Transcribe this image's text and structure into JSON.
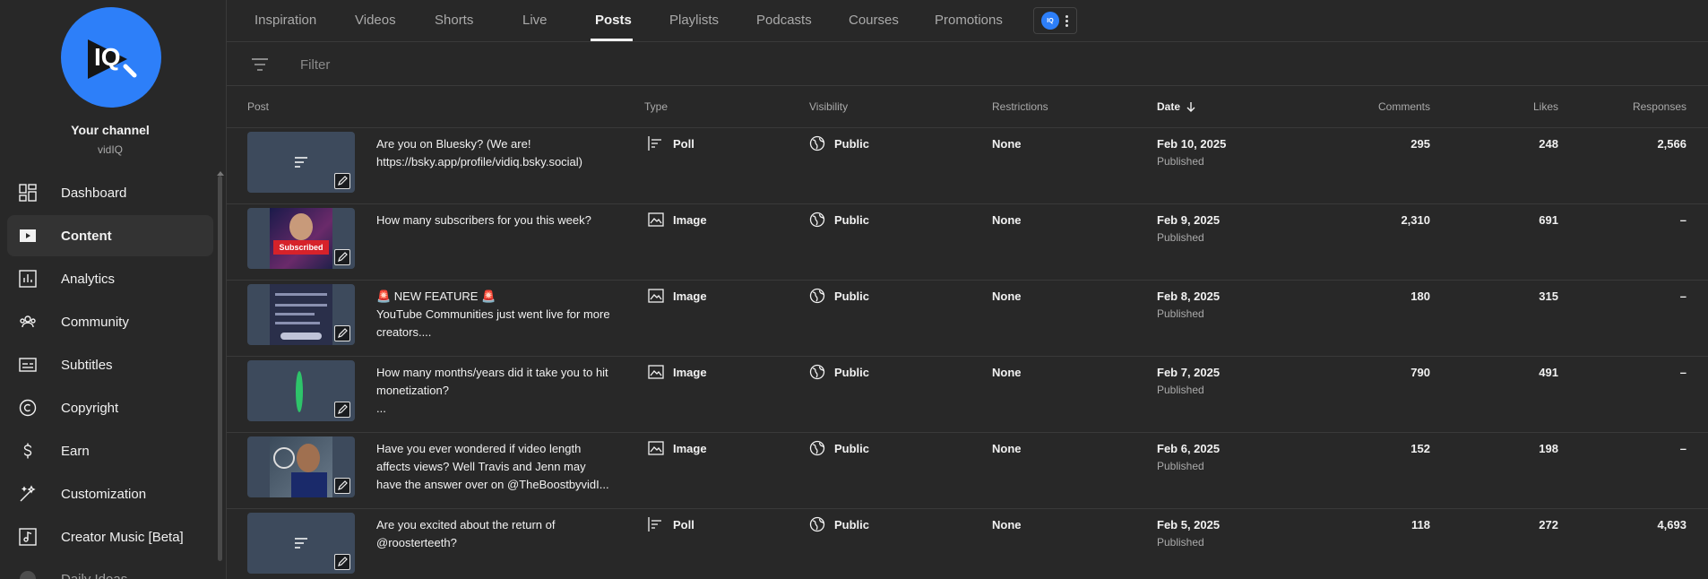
{
  "channel": {
    "title": "Your channel",
    "handle": "vidIQ",
    "logo_text": "IQ"
  },
  "sidebar": {
    "items": [
      {
        "label": "Dashboard",
        "icon": "dashboard-icon"
      },
      {
        "label": "Content",
        "icon": "content-icon",
        "active": true
      },
      {
        "label": "Analytics",
        "icon": "analytics-icon"
      },
      {
        "label": "Community",
        "icon": "community-icon"
      },
      {
        "label": "Subtitles",
        "icon": "subtitles-icon"
      },
      {
        "label": "Copyright",
        "icon": "copyright-icon"
      },
      {
        "label": "Earn",
        "icon": "earn-icon"
      },
      {
        "label": "Customization",
        "icon": "customization-icon"
      },
      {
        "label": "Creator Music [Beta]",
        "icon": "creator-music-icon"
      },
      {
        "label": "Daily Ideas",
        "icon": "daily-ideas-icon"
      }
    ]
  },
  "tabs": [
    {
      "label": "Inspiration"
    },
    {
      "label": "Videos"
    },
    {
      "label": "Shorts"
    },
    {
      "label": "Live"
    },
    {
      "label": "Posts",
      "active": true
    },
    {
      "label": "Playlists"
    },
    {
      "label": "Podcasts"
    },
    {
      "label": "Courses"
    },
    {
      "label": "Promotions"
    }
  ],
  "extension": {
    "logo_text": "IQ"
  },
  "filter": {
    "placeholder": "Filter"
  },
  "table": {
    "headers": {
      "post": "Post",
      "type": "Type",
      "visibility": "Visibility",
      "restrictions": "Restrictions",
      "date": "Date",
      "comments": "Comments",
      "likes": "Likes",
      "responses": "Responses"
    },
    "sort": {
      "column": "date",
      "direction": "descending"
    },
    "rows": [
      {
        "text": "Are you on Bluesky? (We are! https://bsky.app/profile/vidiq.bsky.social)",
        "thumbnail": "text-post-icon",
        "type": "Poll",
        "visibility": "Public",
        "restrictions": "None",
        "date": "Feb 10, 2025",
        "status": "Published",
        "comments": "295",
        "likes": "248",
        "responses": "2,566"
      },
      {
        "text": "How many subscribers for you this week?",
        "thumbnail": "subscribed-photo",
        "thumbnail_caption": "Subscribed",
        "type": "Image",
        "visibility": "Public",
        "restrictions": "None",
        "date": "Feb 9, 2025",
        "status": "Published",
        "comments": "2,310",
        "likes": "691",
        "responses": "–"
      },
      {
        "text": "🚨 NEW FEATURE 🚨\nYouTube Communities just went live for more creators....",
        "thumbnail": "screenshot-photo",
        "type": "Image",
        "visibility": "Public",
        "restrictions": "None",
        "date": "Feb 8, 2025",
        "status": "Published",
        "comments": "180",
        "likes": "315",
        "responses": "–"
      },
      {
        "text": "How many months/years did it take you to hit monetization?\n...",
        "thumbnail": "green-leaf-photo",
        "type": "Image",
        "visibility": "Public",
        "restrictions": "None",
        "date": "Feb 7, 2025",
        "status": "Published",
        "comments": "790",
        "likes": "491",
        "responses": "–"
      },
      {
        "text": "Have you ever wondered if video length affects views?  Well Travis and Jenn may have the answer over on @TheBoostbyvidI...",
        "thumbnail": "person-clock-photo",
        "type": "Image",
        "visibility": "Public",
        "restrictions": "None",
        "date": "Feb 6, 2025",
        "status": "Published",
        "comments": "152",
        "likes": "198",
        "responses": "–"
      },
      {
        "text": "Are you excited about the return of @roosterteeth?",
        "thumbnail": "text-post-icon",
        "type": "Poll",
        "visibility": "Public",
        "restrictions": "None",
        "date": "Feb 5, 2025",
        "status": "Published",
        "comments": "118",
        "likes": "272",
        "responses": "4,693"
      }
    ]
  },
  "colors": {
    "background": "#282828",
    "brand_blue": "#2d7ff9",
    "text_primary": "#f1f1f1",
    "text_secondary": "#aaaaaa",
    "divider": "#3a3a3a"
  }
}
